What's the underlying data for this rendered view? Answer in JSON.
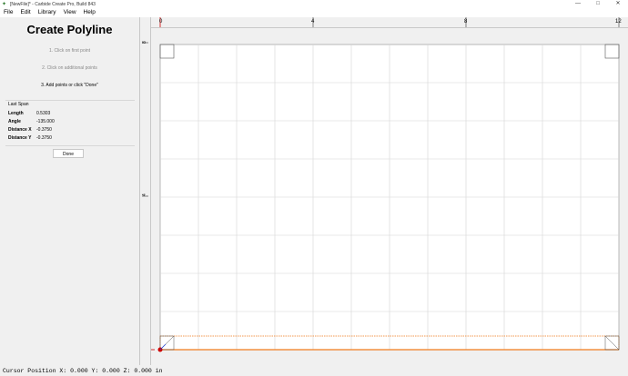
{
  "window": {
    "title": "[NewFile]* - Carbide Create Pro, Build 843",
    "controls": [
      "—",
      "□",
      "✕"
    ]
  },
  "menu": [
    "File",
    "Edit",
    "Library",
    "View",
    "Help"
  ],
  "panel": {
    "title": "Create Polyline",
    "steps": [
      {
        "text": "1. Click on first point",
        "active": false
      },
      {
        "text": "2. Click on additional points",
        "active": false
      },
      {
        "text": "3. Add points or click \"Done\"",
        "active": true
      }
    ],
    "last_span": {
      "title": "Last Span",
      "rows": [
        {
          "label": "Length",
          "value": "0.5303"
        },
        {
          "label": "Angle",
          "value": "-135.000"
        },
        {
          "label": "Distance X",
          "value": "-0.3750"
        },
        {
          "label": "Distance Y",
          "value": "-0.3750"
        }
      ]
    },
    "done_label": "Done"
  },
  "ruler": {
    "top_labels": [
      "0",
      "4",
      "8",
      "12"
    ],
    "left_labels": [
      "8",
      "4"
    ]
  },
  "canvas": {
    "grid_color": "#d6d6d6",
    "stock_color": "#f07a1a",
    "origin_color": "#cc0000"
  },
  "status": "Cursor Position X: 0.000 Y: 0.000 Z: 0.000 in"
}
